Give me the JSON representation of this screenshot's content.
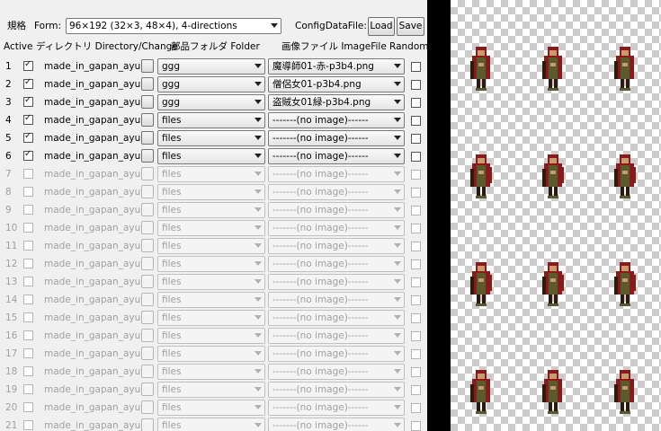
{
  "toolbar": {
    "form_label_jp": "規格",
    "form_label_en": "Form:",
    "form_value": "96×192 (32×3, 48×4), 4-directions",
    "config_label": "ConfigDataFile:",
    "load_label": "Load",
    "save_label": "Save"
  },
  "header": {
    "active": "Active",
    "directory": "ディレクトリ Directory/Change",
    "folder": "部品フォルダ Folder",
    "image": "画像ファイル ImageFile",
    "random": "Random"
  },
  "rows": [
    {
      "num": "1",
      "active": true,
      "dir": "made_in_gapan_ayumu",
      "folder": "ggg",
      "image": "魔導師01-赤-p3b4.png"
    },
    {
      "num": "2",
      "active": true,
      "dir": "made_in_gapan_ayumu",
      "folder": "ggg",
      "image": "僧侶女01-p3b4.png"
    },
    {
      "num": "3",
      "active": true,
      "dir": "made_in_gapan_ayumu",
      "folder": "ggg",
      "image": "盗賊女01緑-p3b4.png"
    },
    {
      "num": "4",
      "active": true,
      "dir": "made_in_gapan_ayumu",
      "folder": "files",
      "image": "-------(no image)------"
    },
    {
      "num": "5",
      "active": true,
      "dir": "made_in_gapan_ayumu",
      "folder": "files",
      "image": "-------(no image)------"
    },
    {
      "num": "6",
      "active": true,
      "dir": "made_in_gapan_ayumu",
      "folder": "files",
      "image": "-------(no image)------"
    },
    {
      "num": "7",
      "active": false,
      "dir": "made_in_gapan_ayumu",
      "folder": "files",
      "image": "-------(no image)------"
    },
    {
      "num": "8",
      "active": false,
      "dir": "made_in_gapan_ayumu",
      "folder": "files",
      "image": "-------(no image)------"
    },
    {
      "num": "9",
      "active": false,
      "dir": "made_in_gapan_ayumu",
      "folder": "files",
      "image": "-------(no image)------"
    },
    {
      "num": "10",
      "active": false,
      "dir": "made_in_gapan_ayumu",
      "folder": "files",
      "image": "-------(no image)------"
    },
    {
      "num": "11",
      "active": false,
      "dir": "made_in_gapan_ayumu",
      "folder": "files",
      "image": "-------(no image)------"
    },
    {
      "num": "12",
      "active": false,
      "dir": "made_in_gapan_ayumu",
      "folder": "files",
      "image": "-------(no image)------"
    },
    {
      "num": "13",
      "active": false,
      "dir": "made_in_gapan_ayumu",
      "folder": "files",
      "image": "-------(no image)------"
    },
    {
      "num": "14",
      "active": false,
      "dir": "made_in_gapan_ayumu",
      "folder": "files",
      "image": "-------(no image)------"
    },
    {
      "num": "15",
      "active": false,
      "dir": "made_in_gapan_ayumu",
      "folder": "files",
      "image": "-------(no image)------"
    },
    {
      "num": "16",
      "active": false,
      "dir": "made_in_gapan_ayumu",
      "folder": "files",
      "image": "-------(no image)------"
    },
    {
      "num": "17",
      "active": false,
      "dir": "made_in_gapan_ayumu",
      "folder": "files",
      "image": "-------(no image)------"
    },
    {
      "num": "18",
      "active": false,
      "dir": "made_in_gapan_ayumu",
      "folder": "files",
      "image": "-------(no image)------"
    },
    {
      "num": "19",
      "active": false,
      "dir": "made_in_gapan_ayumu",
      "folder": "files",
      "image": "-------(no image)------"
    },
    {
      "num": "20",
      "active": false,
      "dir": "made_in_gapan_ayumu",
      "folder": "files",
      "image": "-------(no image)------"
    },
    {
      "num": "21",
      "active": false,
      "dir": "made_in_gapan_ayumu",
      "folder": "files",
      "image": "-------(no image)------"
    }
  ],
  "preview": {
    "sprite_colors": {
      "cloak": "#8b1a1a",
      "body": "#5a5a2a",
      "skin": "#c89a70",
      "outline": "#2a1a10"
    }
  }
}
